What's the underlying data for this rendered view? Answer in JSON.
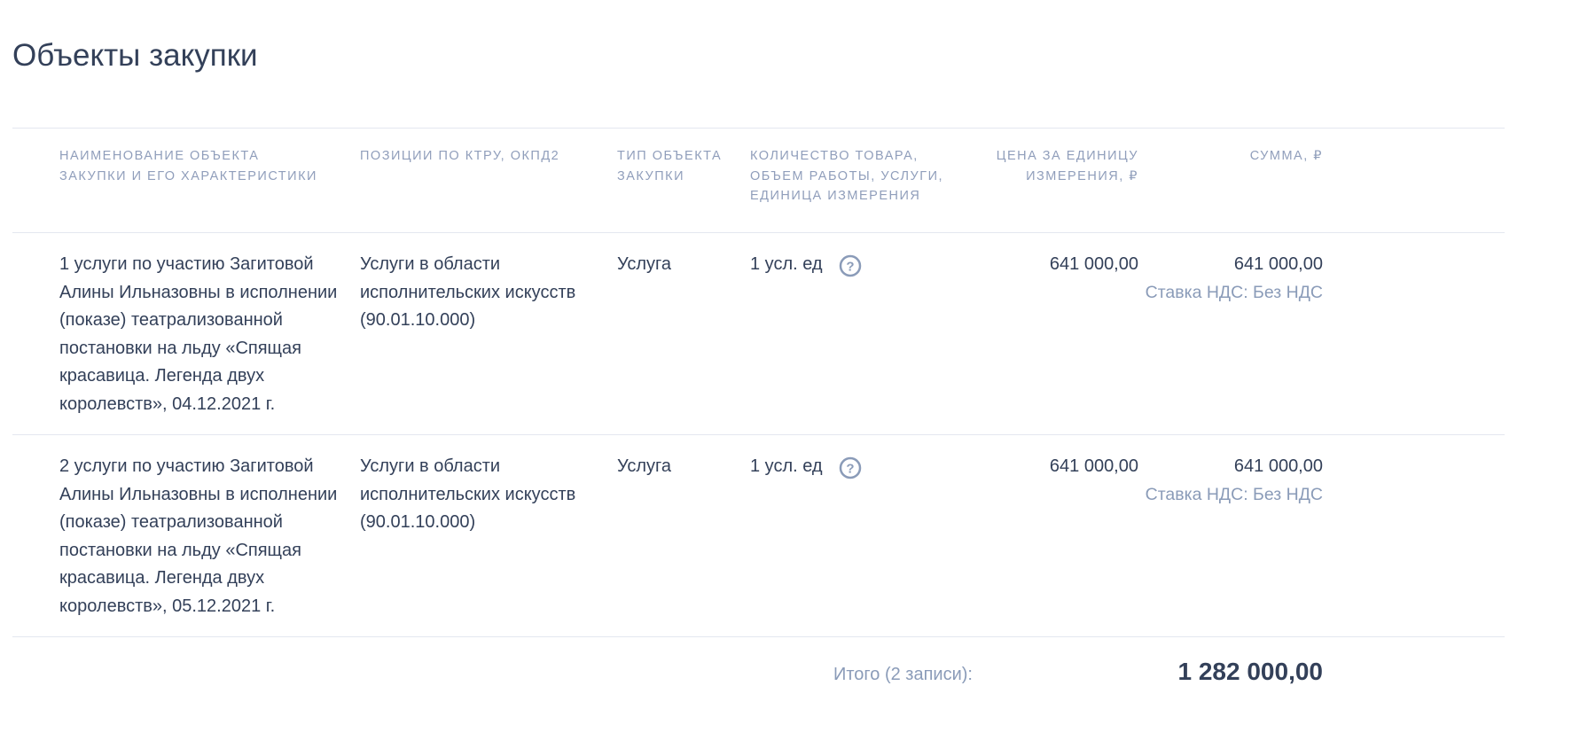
{
  "page": {
    "title": "Объекты закупки"
  },
  "table": {
    "headers": {
      "name": "НАИМЕНОВАНИЕ ОБЪЕКТА ЗАКУПКИ И ЕГО ХАРАКТЕРИСТИКИ",
      "positions": "ПОЗИЦИИ ПО КТРУ, ОКПД2",
      "type": "ТИП ОБЪЕКТА ЗАКУПКИ",
      "quantity": "КОЛИЧЕСТВО ТОВАРА, ОБЪЕМ РАБОТЫ, УСЛУГИ, ЕДИНИЦА ИЗМЕРЕНИЯ",
      "unit_price": "ЦЕНА ЗА ЕДИНИЦУ ИЗМЕРЕНИЯ, ₽",
      "sum": "СУММА, ₽"
    },
    "rows": [
      {
        "name": "1 услуги по участию Загитовой Алины Ильназовны в исполнении (показе) театрализованной постановки на льду «Спящая красавица. Легенда двух королевств», 04.12.2021 г.",
        "positions": "Услуги в области исполнительских искусств (90.01.10.000)",
        "type": "Услуга",
        "quantity": "1 усл. ед",
        "quantity_icon": "question-circle-icon",
        "unit_price": "641 000,00",
        "sum": "641 000,00",
        "vat": "Ставка НДС: Без НДС"
      },
      {
        "name": "2 услуги по участию Загитовой Алины Ильназовны в исполнении (показе) театрализованной постановки на льду «Спящая красавица. Легенда двух королевств», 05.12.2021 г.",
        "positions": "Услуги в области исполнительских искусств (90.01.10.000)",
        "type": "Услуга",
        "quantity": "1 усл. ед",
        "quantity_icon": "question-circle-icon",
        "unit_price": "641 000,00",
        "sum": "641 000,00",
        "vat": "Ставка НДС: Без НДС"
      }
    ]
  },
  "total": {
    "label": "Итого (2 записи):",
    "value": "1 282 000,00"
  },
  "colors": {
    "text": "#334059",
    "muted": "#909ebb",
    "divider": "#e4e7f0",
    "icon": "#8a9bb8"
  }
}
